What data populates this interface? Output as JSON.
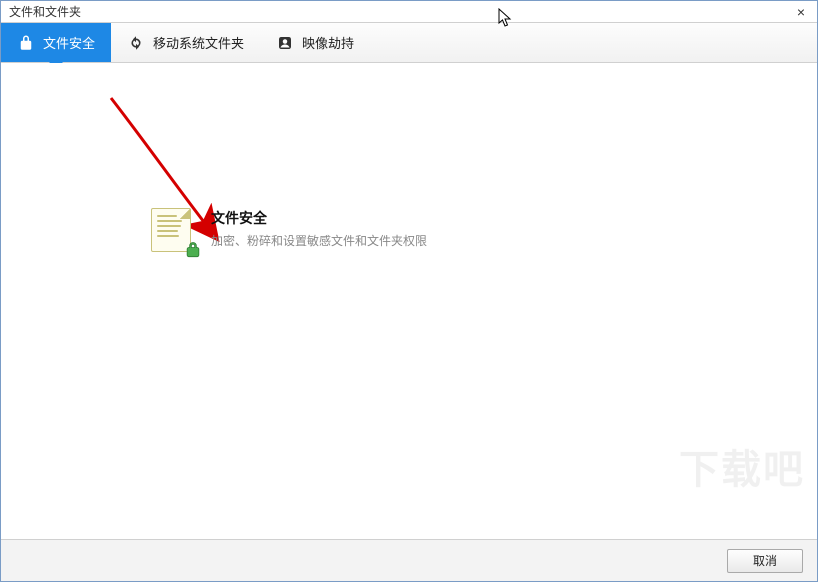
{
  "window": {
    "title": "文件和文件夹",
    "close_label": "×"
  },
  "tabs": [
    {
      "label": "文件安全",
      "icon": "lock-icon",
      "active": true
    },
    {
      "label": "移动系统文件夹",
      "icon": "refresh-icon",
      "active": false
    },
    {
      "label": "映像劫持",
      "icon": "badge-icon",
      "active": false
    }
  ],
  "feature": {
    "title": "文件安全",
    "description": "加密、粉碎和设置敏感文件和文件夹权限"
  },
  "footer": {
    "cancel_label": "取消"
  },
  "watermark": "下载吧"
}
